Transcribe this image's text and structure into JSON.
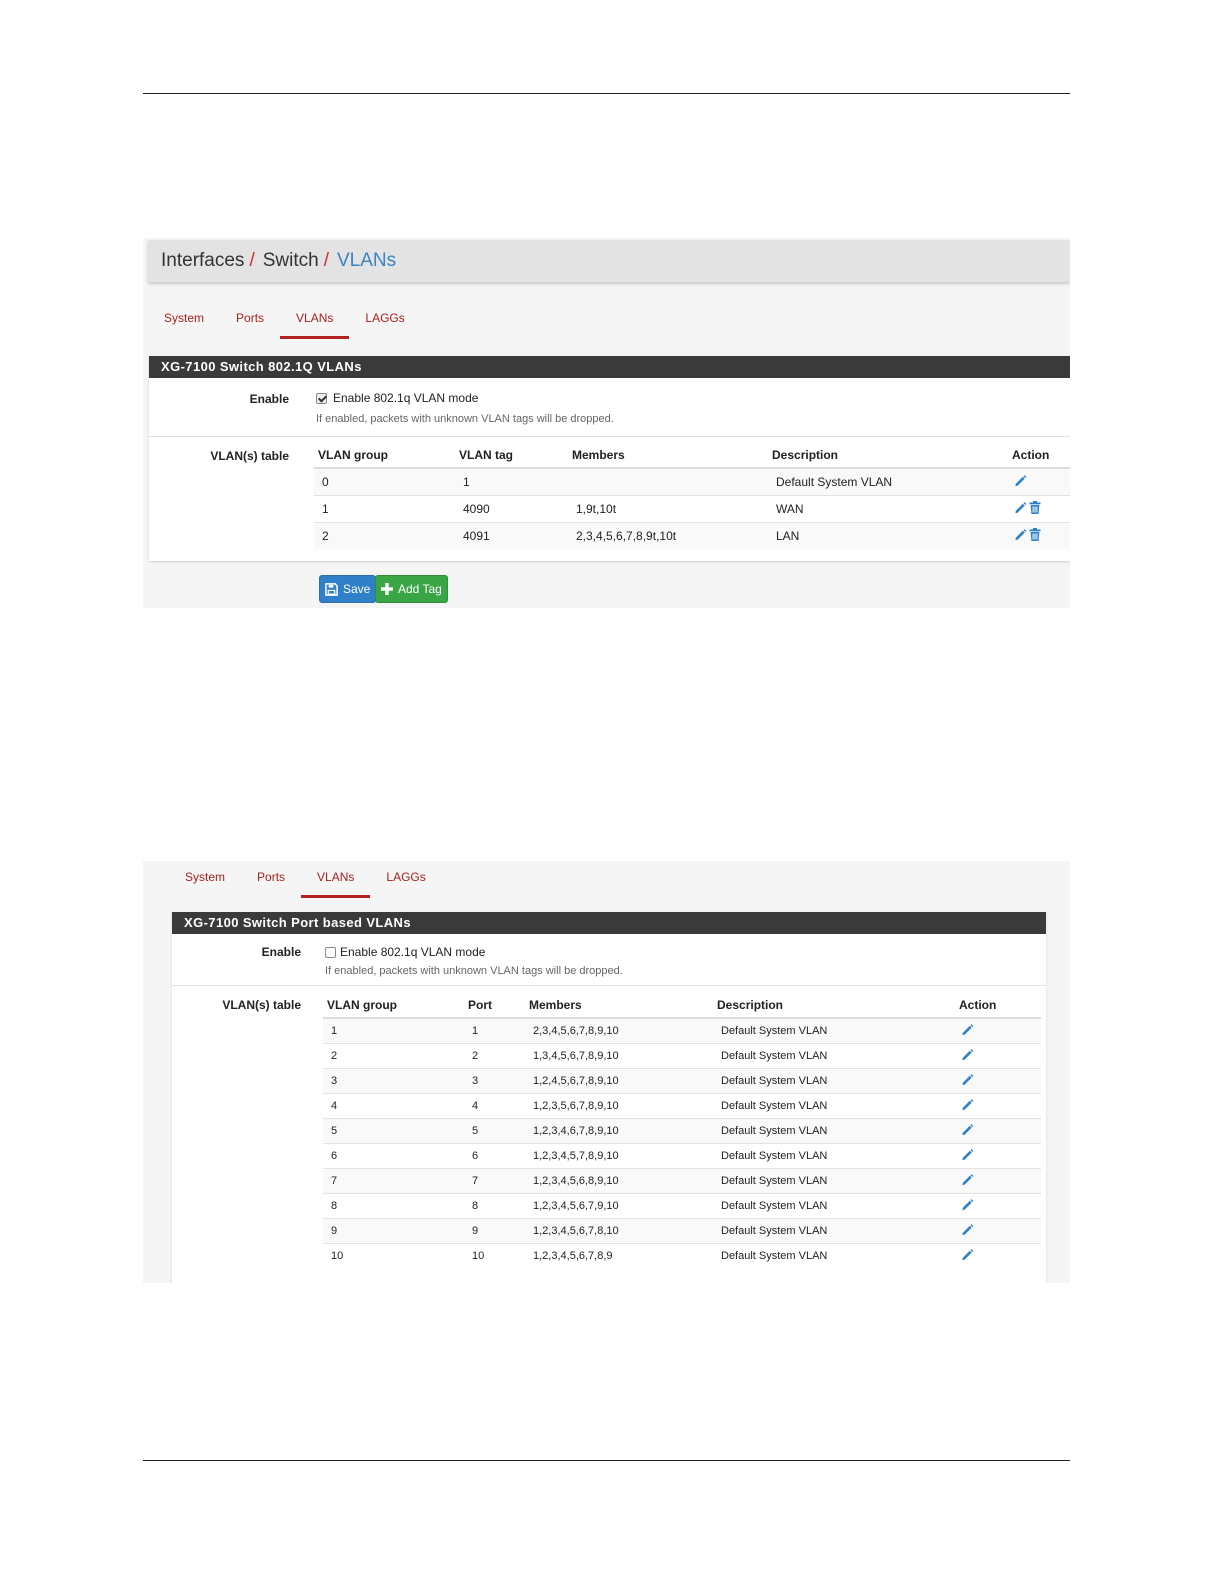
{
  "colors": {
    "accent_red": "#b22222",
    "link_blue": "#3a84c4",
    "panel_header": "#3a3a3a",
    "save_blue": "#2f7fc9",
    "add_green": "#3aa545"
  },
  "shot1": {
    "breadcrumb": {
      "part1": "Interfaces",
      "part2": "Switch",
      "current": "VLANs",
      "separator": "/"
    },
    "tabs": [
      "System",
      "Ports",
      "VLANs",
      "LAGGs"
    ],
    "active_tab": "VLANs",
    "panel_title": "XG-7100 Switch 802.1Q VLANs",
    "enable_label": "Enable",
    "enable_checked": true,
    "enable_text": "Enable 802.1q VLAN mode",
    "enable_help": "If enabled, packets with unknown VLAN tags will be dropped.",
    "table_label": "VLAN(s) table",
    "columns": [
      "VLAN group",
      "VLAN tag",
      "Members",
      "Description",
      "Action"
    ],
    "rows": [
      {
        "group": "0",
        "tag": "1",
        "members": "",
        "description": "Default System VLAN",
        "actions": [
          "edit-icon"
        ]
      },
      {
        "group": "1",
        "tag": "4090",
        "members": "1,9t,10t",
        "description": "WAN",
        "actions": [
          "edit-icon",
          "delete-icon"
        ]
      },
      {
        "group": "2",
        "tag": "4091",
        "members": "2,3,4,5,6,7,8,9t,10t",
        "description": "LAN",
        "actions": [
          "edit-icon",
          "delete-icon"
        ]
      }
    ],
    "buttons": {
      "save": "Save",
      "add_tag": "Add Tag"
    }
  },
  "shot2": {
    "tabs": [
      "System",
      "Ports",
      "VLANs",
      "LAGGs"
    ],
    "active_tab": "VLANs",
    "panel_title": "XG-7100 Switch Port based VLANs",
    "enable_label": "Enable",
    "enable_checked": false,
    "enable_text": "Enable 802.1q VLAN mode",
    "enable_help": "If enabled, packets with unknown VLAN tags will be dropped.",
    "table_label": "VLAN(s) table",
    "columns": [
      "VLAN group",
      "Port",
      "Members",
      "Description",
      "Action"
    ],
    "rows": [
      {
        "group": "1",
        "port": "1",
        "members": "2,3,4,5,6,7,8,9,10",
        "description": "Default System VLAN"
      },
      {
        "group": "2",
        "port": "2",
        "members": "1,3,4,5,6,7,8,9,10",
        "description": "Default System VLAN"
      },
      {
        "group": "3",
        "port": "3",
        "members": "1,2,4,5,6,7,8,9,10",
        "description": "Default System VLAN"
      },
      {
        "group": "4",
        "port": "4",
        "members": "1,2,3,5,6,7,8,9,10",
        "description": "Default System VLAN"
      },
      {
        "group": "5",
        "port": "5",
        "members": "1,2,3,4,6,7,8,9,10",
        "description": "Default System VLAN"
      },
      {
        "group": "6",
        "port": "6",
        "members": "1,2,3,4,5,7,8,9,10",
        "description": "Default System VLAN"
      },
      {
        "group": "7",
        "port": "7",
        "members": "1,2,3,4,5,6,8,9,10",
        "description": "Default System VLAN"
      },
      {
        "group": "8",
        "port": "8",
        "members": "1,2,3,4,5,6,7,9,10",
        "description": "Default System VLAN"
      },
      {
        "group": "9",
        "port": "9",
        "members": "1,2,3,4,5,6,7,8,10",
        "description": "Default System VLAN"
      },
      {
        "group": "10",
        "port": "10",
        "members": "1,2,3,4,5,6,7,8,9",
        "description": "Default System VLAN"
      }
    ]
  }
}
